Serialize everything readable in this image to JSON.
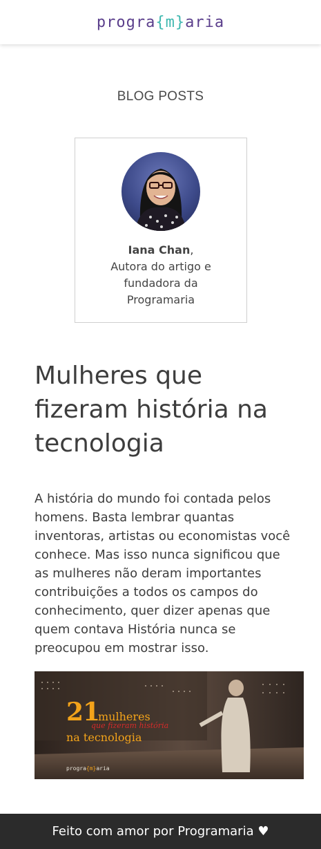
{
  "header": {
    "logo_prefix": "progra",
    "logo_accent": "{m}",
    "logo_suffix": "aria",
    "brand_color": "#5b3f8c",
    "accent_color": "#3fb8b0"
  },
  "section": {
    "title": "BLOG POSTS"
  },
  "author": {
    "name": "Iana Chan",
    "name_suffix": ",",
    "line1": "Autora do artigo e",
    "line2": "fundadora da",
    "line3": "Programaria"
  },
  "article": {
    "title": "Mulheres que fizeram história na tecnologia",
    "body": "A história do mundo foi contada pelos homens. Basta lembrar quantas inventoras, artistas ou economistas você conhece. Mas isso nunca significou que as mulheres não deram importantes contribuições a todos os campos do conhecimento, quer dizer apenas que quem contava História nunca se preocupou em mostrar isso."
  },
  "hero_image": {
    "number": "21",
    "line1": "mulheres",
    "line2": "que fizeram história",
    "line3": "na tecnologia",
    "logo_prefix": "progra",
    "logo_accent": "{m}",
    "logo_suffix": "aria"
  },
  "footer": {
    "text": "Feito com amor por Programaria ♥"
  }
}
